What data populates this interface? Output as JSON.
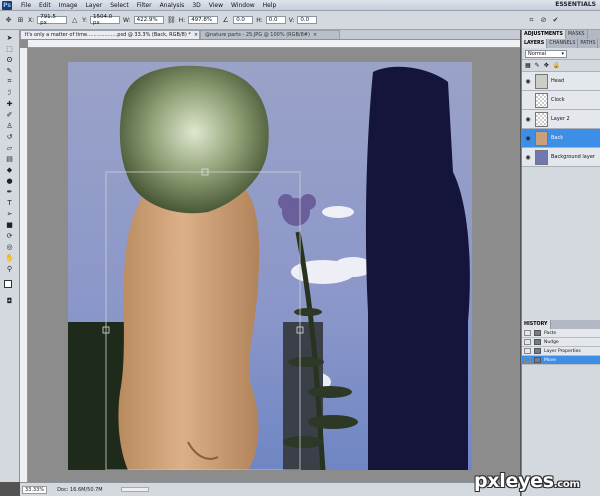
{
  "app": {
    "logo_text": "Ps",
    "workspace": "ESSENTIALS"
  },
  "menu": [
    "File",
    "Edit",
    "Image",
    "Layer",
    "Select",
    "Filter",
    "Analysis",
    "3D",
    "View",
    "Window",
    "Help"
  ],
  "options": {
    "x_label": "X:",
    "x_value": "791.5 px",
    "y_label": "Y:",
    "y_value": "1504.0 px",
    "w_label": "W:",
    "w_value": "422.9%",
    "h_label": "H:",
    "h_value": "497.8%",
    "rot_value": "0.0",
    "hskew_label": "H:",
    "hskew_value": "0.0",
    "vskew_label": "V:",
    "vskew_value": "0.0"
  },
  "tabs": [
    {
      "label": "It's only a matter of time...................psd @ 33.3% (Back, RGB/8) *",
      "active": true
    },
    {
      "label": "@nature parts - 25.JPG @ 100% (RGB/8#)",
      "active": false
    }
  ],
  "status": {
    "zoom": "33.33%",
    "doc": "Doc: 16.6M/50.7M"
  },
  "layers_panel": {
    "tabs": [
      "ADJUSTMENTS",
      "MASKS",
      "LAYERS",
      "CHANNELS",
      "PATHS"
    ],
    "active_tab": "LAYERS",
    "blend_mode": "Normal",
    "layers": [
      {
        "name": "Head",
        "visible": true,
        "selected": false
      },
      {
        "name": "Clock",
        "visible": false,
        "selected": false
      },
      {
        "name": "Layer 2",
        "visible": true,
        "selected": false
      },
      {
        "name": "Back",
        "visible": true,
        "selected": true
      },
      {
        "name": "Background layer",
        "visible": true,
        "selected": false
      }
    ]
  },
  "history_panel": {
    "title": "HISTORY",
    "items": [
      {
        "label": "Paste",
        "selected": false
      },
      {
        "label": "Nudge",
        "selected": false
      },
      {
        "label": "Layer Properties",
        "selected": false
      },
      {
        "label": "Move",
        "selected": true
      }
    ]
  },
  "watermark": {
    "main": "pxleyes",
    "suffix": ".com"
  }
}
